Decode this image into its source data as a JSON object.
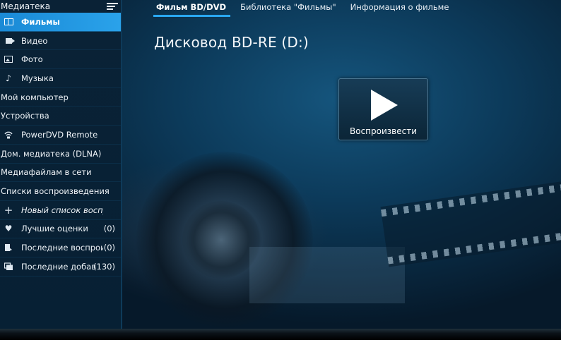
{
  "sidebar": {
    "header": "Медиатека",
    "items": [
      {
        "label": "Фильмы",
        "icon": "film-icon",
        "active": true
      },
      {
        "label": "Видео",
        "icon": "video-camera-icon"
      },
      {
        "label": "Фото",
        "icon": "photo-icon"
      },
      {
        "label": "Музыка",
        "icon": "music-note-icon"
      },
      {
        "label": "Мой компьютер"
      },
      {
        "label": "Устройства"
      },
      {
        "label": "PowerDVD Remote",
        "icon": "wireless-icon"
      },
      {
        "label": "Дом. медиатека (DLNA)"
      },
      {
        "label": "Медиафайлам в сети"
      },
      {
        "label": "Списки воспроизведения"
      },
      {
        "label": "Новый список воспроиз",
        "icon": "plus-icon"
      },
      {
        "label": "Лучшие оценки",
        "count": "(0)",
        "icon": "heart-icon"
      },
      {
        "label": "Последние воспрои",
        "count": "(0)",
        "icon": "recent-played-icon"
      },
      {
        "label": "Последние добав",
        "count": "(130)",
        "icon": "recent-added-icon"
      }
    ]
  },
  "tabs": [
    {
      "label": "Фильм BD/DVD",
      "active": true
    },
    {
      "label": "Библиотека \"Фильмы\""
    },
    {
      "label": "Информация о фильме"
    }
  ],
  "main": {
    "drive_title": "Дисковод BD-RE (D:)",
    "play_label": "Воспроизвести"
  },
  "colors": {
    "accent": "#2aa2ea",
    "sidebar_bg": "#0a2236",
    "main_bg": "#0c3a5a"
  }
}
